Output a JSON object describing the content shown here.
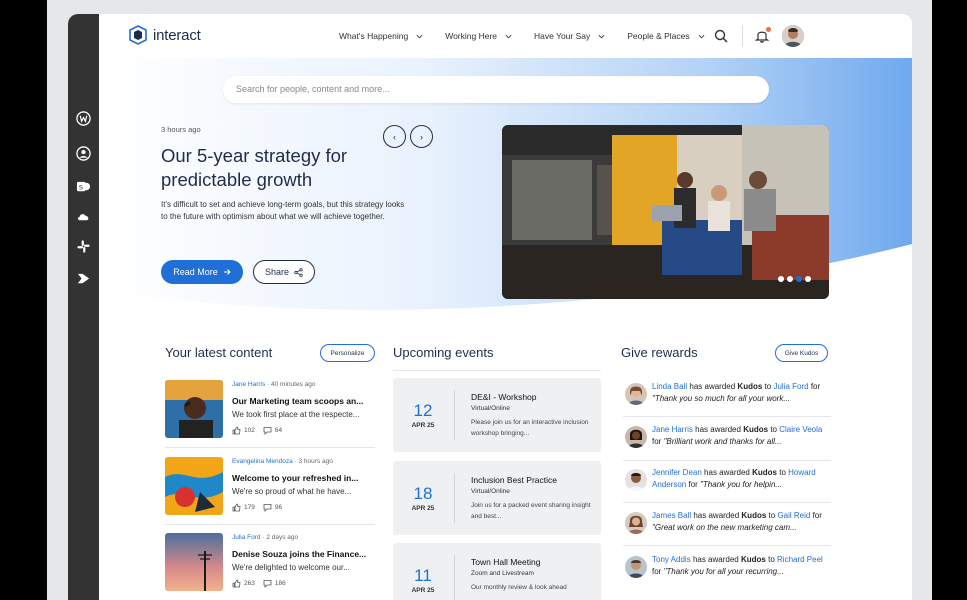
{
  "app": {
    "logo_text": "interact"
  },
  "nav": [
    "What's Happening",
    "Working Here",
    "Have Your Say",
    "People & Places"
  ],
  "search": {
    "placeholder": "Search for people, content and more..."
  },
  "hero": {
    "time": "3 hours ago",
    "title": "Our 5-year strategy for predictable growth",
    "description": "It's difficult to set and achieve long-term goals, but this strategy looks to the future with optimism about what we will achieve together.",
    "read_more": "Read More",
    "share": "Share"
  },
  "latest": {
    "title": "Your latest content",
    "action": "Personalize",
    "items": [
      {
        "author": "Jane Harris",
        "time": "40 minutes ago",
        "title": "Our Marketing team scoops an...",
        "body": "We took first place at the respecte...",
        "likes": "102",
        "comments": "64"
      },
      {
        "author": "Evangelina Mendoza",
        "time": "3 hours ago",
        "title": "Welcome to your refreshed in...",
        "body": "We're so proud of what he have...",
        "likes": "179",
        "comments": "96"
      },
      {
        "author": "Julia Ford",
        "time": "2 days ago",
        "title": "Denise Souza joins the Finance...",
        "body": "We're delighted to welcome our...",
        "likes": "263",
        "comments": "186"
      }
    ]
  },
  "events": {
    "title": "Upcoming events",
    "items": [
      {
        "day": "12",
        "month": "APR 25",
        "title": "DE&I - Workshop",
        "type": "Virtual/Online",
        "desc": "Please join us for an interactive inclusion workshop bringing..."
      },
      {
        "day": "18",
        "month": "APR 25",
        "title": "Inclusion Best Practice",
        "type": "Virtual/Online",
        "desc": "Join us for a packed event sharing insight and best..."
      },
      {
        "day": "11",
        "month": "APR 25",
        "title": "Town Hall Meeting",
        "type": "Zoom and Livestream",
        "desc": "Our monthly review & look ahead"
      }
    ]
  },
  "rewards": {
    "title": "Give rewards",
    "action": "Give Kudos",
    "items": [
      {
        "from": "Linda Ball",
        "to": "Julia Ford",
        "quote": "\"Thank you so much for all your work..."
      },
      {
        "from": "Jane Harris",
        "to": "Claire Veola",
        "quote": "\"Brilliant work and thanks for all..."
      },
      {
        "from": "Jennifer Dean",
        "to": "Howard Anderson",
        "quote": "\"Thank you for helpin..."
      },
      {
        "from": "James Ball",
        "to": "Gail Reid",
        "quote": "\"Great work on the new marketing cam..."
      },
      {
        "from": "Tony Addis",
        "to": "Richard Peel",
        "quote": "\"Thank you for all your recurring..."
      }
    ],
    "has_awarded": "has awarded",
    "kudos": "Kudos",
    "to_word": "to",
    "for_word": "for"
  }
}
